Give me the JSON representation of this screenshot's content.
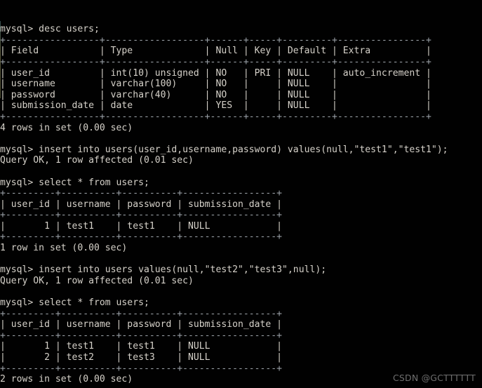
{
  "terminal": {
    "prompt": "mysql>",
    "background_color": "#010101",
    "text_color": "#d6d2ca",
    "lines": [
      "mysql> desc users;",
      "+-----------------+------------------+------+-----+---------+----------------+",
      "| Field           | Type             | Null | Key | Default | Extra          |",
      "+-----------------+------------------+------+-----+---------+----------------+",
      "| user_id         | int(10) unsigned | NO   | PRI | NULL    | auto_increment |",
      "| username        | varchar(100)     | NO   |     | NULL    |                |",
      "| password        | varchar(40)      | NO   |     | NULL    |                |",
      "| submission_date | date             | YES  |     | NULL    |                |",
      "+-----------------+------------------+------+-----+---------+----------------+",
      "4 rows in set (0.00 sec)",
      "",
      "mysql> insert into users(user_id,username,password) values(null,\"test1\",\"test1\");",
      "Query OK, 1 row affected (0.01 sec)",
      "",
      "mysql> select * from users;",
      "+---------+----------+----------+-----------------+",
      "| user_id | username | password | submission_date |",
      "+---------+----------+----------+-----------------+",
      "|       1 | test1    | test1    | NULL            |",
      "+---------+----------+----------+-----------------+",
      "1 row in set (0.00 sec)",
      "",
      "mysql> insert into users values(null,\"test2\",\"test3\",null);",
      "Query OK, 1 row affected (0.01 sec)",
      "",
      "mysql> select * from users;",
      "+---------+----------+----------+-----------------+",
      "| user_id | username | password | submission_date |",
      "+---------+----------+----------+-----------------+",
      "|       1 | test1    | test1    | NULL            |",
      "|       2 | test2    | test3    | NULL            |",
      "+---------+----------+----------+-----------------+",
      "2 rows in set (0.00 sec)"
    ],
    "commands": [
      "desc users;",
      "insert into users(user_id,username,password) values(null,\"test1\",\"test1\");",
      "select * from users;",
      "insert into users values(null,\"test2\",\"test3\",null);",
      "select * from users;"
    ],
    "status_messages": [
      "4 rows in set (0.00 sec)",
      "Query OK, 1 row affected (0.01 sec)",
      "1 row in set (0.00 sec)",
      "Query OK, 1 row affected (0.01 sec)",
      "2 rows in set (0.00 sec)"
    ],
    "describe_table": {
      "headers": [
        "Field",
        "Type",
        "Null",
        "Key",
        "Default",
        "Extra"
      ],
      "rows": [
        [
          "user_id",
          "int(10) unsigned",
          "NO",
          "PRI",
          "NULL",
          "auto_increment"
        ],
        [
          "username",
          "varchar(100)",
          "NO",
          "",
          "NULL",
          ""
        ],
        [
          "password",
          "varchar(40)",
          "NO",
          "",
          "NULL",
          ""
        ],
        [
          "submission_date",
          "date",
          "YES",
          "",
          "NULL",
          ""
        ]
      ],
      "row_count_text": "4 rows in set (0.00 sec)"
    },
    "select_result_first": {
      "headers": [
        "user_id",
        "username",
        "password",
        "submission_date"
      ],
      "rows": [
        [
          "1",
          "test1",
          "test1",
          "NULL"
        ]
      ],
      "row_count_text": "1 row in set (0.00 sec)"
    },
    "select_result_second": {
      "headers": [
        "user_id",
        "username",
        "password",
        "submission_date"
      ],
      "rows": [
        [
          "1",
          "test1",
          "test1",
          "NULL"
        ],
        [
          "2",
          "test2",
          "test3",
          "NULL"
        ]
      ],
      "row_count_text": "2 rows in set (0.00 sec)"
    }
  },
  "watermark": {
    "text": "CSDN @GCTTTTTT",
    "color": "#6f6f6f"
  }
}
